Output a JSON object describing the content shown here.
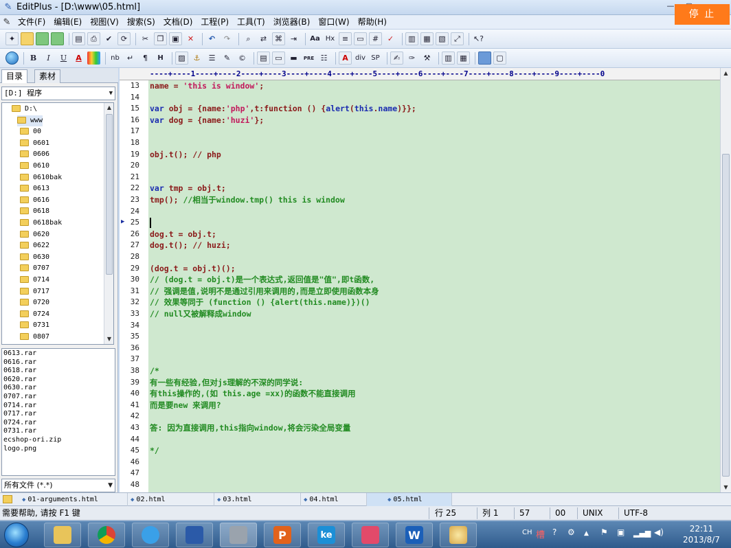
{
  "window": {
    "title": "EditPlus - [D:\\www\\05.html]"
  },
  "stop_button": "停 止",
  "menu": [
    "文件(F)",
    "编辑(E)",
    "视图(V)",
    "搜索(S)",
    "文档(D)",
    "工程(P)",
    "工具(T)",
    "浏览器(B)",
    "窗口(W)",
    "帮助(H)"
  ],
  "toolbar2_labels": {
    "bold": "B",
    "italic": "I",
    "underline": "U",
    "font": "A",
    "nb": "nb",
    "enter": "↵",
    "para": "¶",
    "hr": "H",
    "pre": "PRE",
    "abs": "A",
    "div": "div",
    "sp": "SP",
    "hx": "Hx",
    "aa": "Aa"
  },
  "left_pane": {
    "tabs": [
      "目录",
      "素材"
    ],
    "drive": "[D:] 程序",
    "tree": [
      "D:\\",
      "www",
      "00",
      "0601",
      "0606",
      "0610",
      "0610bak",
      "0613",
      "0616",
      "0618",
      "0618bak",
      "0620",
      "0622",
      "0630",
      "0707",
      "0714",
      "0717",
      "0720",
      "0724",
      "0731",
      "0807"
    ],
    "files": [
      "0613.rar",
      "0616.rar",
      "0618.rar",
      "0620.rar",
      "0630.rar",
      "0707.rar",
      "0714.rar",
      "0717.rar",
      "0724.rar",
      "0731.rar",
      "ecshop-ori.zip",
      "logo.png"
    ],
    "filter": "所有文件 (*.*)"
  },
  "ruler": "----+----1----+----2----+----3----+----4----+----5----+----6----+----7----+----8----+----9----+----0",
  "editor": {
    "line_numbers": [
      "13",
      "14",
      "15",
      "16",
      "17",
      "18",
      "19",
      "20",
      "21",
      "22",
      "23",
      "24",
      "25",
      "26",
      "27",
      "28",
      "29",
      "30",
      "31",
      "32",
      "33",
      "34",
      "35",
      "36",
      "37",
      "38",
      "39",
      "40",
      "41",
      "42",
      "43",
      "44",
      "45",
      "46",
      "47",
      "48"
    ],
    "current_line": "25",
    "code_lines": [
      [
        {
          "t": "name = ",
          "c": "pl"
        },
        {
          "t": "'this is window'",
          "c": "str"
        },
        {
          "t": ";",
          "c": "pl"
        }
      ],
      [],
      [
        {
          "t": "var ",
          "c": "kw"
        },
        {
          "t": "obj = {name:",
          "c": "pl"
        },
        {
          "t": "'php'",
          "c": "str"
        },
        {
          "t": ",t:",
          "c": "pl"
        },
        {
          "t": "function",
          "c": "id"
        },
        {
          "t": " () {",
          "c": "pl"
        },
        {
          "t": "alert",
          "c": "kw"
        },
        {
          "t": "(",
          "c": "pl"
        },
        {
          "t": "this",
          "c": "kw"
        },
        {
          "t": ".",
          "c": "pl"
        },
        {
          "t": "name",
          "c": "kw"
        },
        {
          "t": ")}};",
          "c": "pl"
        }
      ],
      [
        {
          "t": "var ",
          "c": "kw"
        },
        {
          "t": "dog = {name:",
          "c": "pl"
        },
        {
          "t": "'huzi'",
          "c": "str"
        },
        {
          "t": "};",
          "c": "pl"
        }
      ],
      [],
      [],
      [
        {
          "t": "obj.t(); ",
          "c": "pl"
        },
        {
          "t": "// php",
          "c": "pl"
        }
      ],
      [],
      [],
      [
        {
          "t": "var ",
          "c": "kw"
        },
        {
          "t": "tmp = obj.t;",
          "c": "pl"
        }
      ],
      [
        {
          "t": "tmp(); ",
          "c": "pl"
        },
        {
          "t": "//相当于window.tmp() this is window",
          "c": "cmt"
        }
      ],
      [],
      [],
      [
        {
          "t": "dog.t = obj.t;",
          "c": "pl"
        }
      ],
      [
        {
          "t": "dog.t(); ",
          "c": "pl"
        },
        {
          "t": "// huzi;",
          "c": "pl"
        }
      ],
      [],
      [
        {
          "t": "(dog.t = obj.t)();",
          "c": "pl"
        }
      ],
      [
        {
          "t": "// (dog.t = obj.t)是一个表达式,返回值是\"值\",即t函数,",
          "c": "cmt"
        }
      ],
      [
        {
          "t": "// 强调是值,说明不是通过引用来调用的,而是立即使用函数本身",
          "c": "cmt"
        }
      ],
      [
        {
          "t": "// 效果等同于 (function () {alert(this.name)})()",
          "c": "cmt"
        }
      ],
      [
        {
          "t": "// null又被解释成window",
          "c": "cmt"
        }
      ],
      [],
      [],
      [],
      [],
      [
        {
          "t": "/*",
          "c": "cmt"
        }
      ],
      [
        {
          "t": "有一些有经验,但对js理解的不深的同学说:",
          "c": "cmt"
        }
      ],
      [
        {
          "t": "有this操作的,(如 this.age =xx)的函数不能直接调用",
          "c": "cmt"
        }
      ],
      [
        {
          "t": "而是要new 来调用?",
          "c": "cmt"
        }
      ],
      [],
      [
        {
          "t": "答: 因为直接调用,this指向window,将会污染全局变量",
          "c": "cmt"
        }
      ],
      [],
      [
        {
          "t": "*/",
          "c": "cmt"
        }
      ],
      [],
      [],
      []
    ]
  },
  "doc_tabs": [
    "01-arguments.html",
    "02.html",
    "03.html",
    "04.html",
    "05.html"
  ],
  "active_doc": "05.html",
  "status": {
    "help": "需要帮助, 请按 F1 键",
    "row": "行 25",
    "col": "列 1",
    "chars": "57",
    "mod": "00",
    "eol": "UNIX",
    "encoding": "UTF-8"
  },
  "tray": {
    "lang": "CH",
    "time": "22:11",
    "date": "2013/8/7"
  },
  "colors": {
    "editor_bg": "#cfe8cf",
    "keyword": "#1a2bb0",
    "string": "#c2185b",
    "comment": "#228b22",
    "plain": "#8b1a1a",
    "stop": "#ff7a1a"
  }
}
